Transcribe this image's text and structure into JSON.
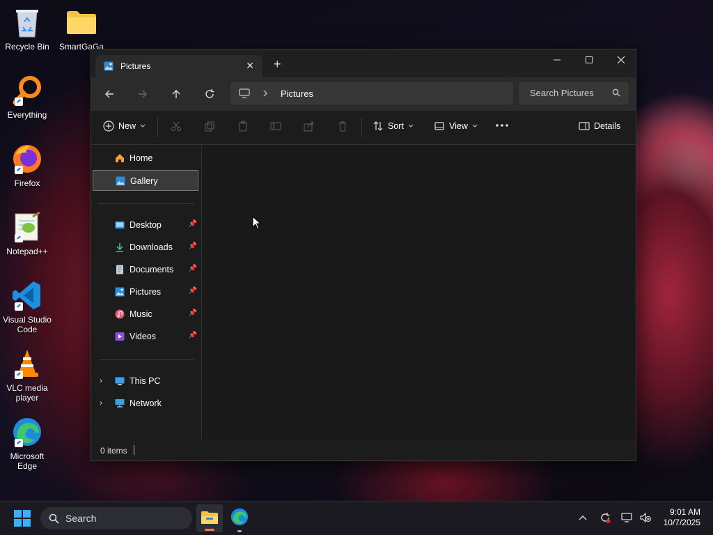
{
  "desktop": {
    "icons": [
      {
        "label": "Recycle Bin"
      },
      {
        "label": "SmartGaGa"
      },
      {
        "label": "Everything"
      },
      {
        "label": "Firefox"
      },
      {
        "label": "Notepad++"
      },
      {
        "label": "Visual Studio Code"
      },
      {
        "label": "VLC media player"
      },
      {
        "label": "Microsoft Edge"
      }
    ]
  },
  "window": {
    "tab_title": "Pictures",
    "tab_close": "✕",
    "new_tab": "+",
    "address_crumb": "Pictures",
    "search_placeholder": "Search Pictures",
    "toolbar": {
      "new_label": "New",
      "sort_label": "Sort",
      "view_label": "View",
      "details_label": "Details"
    },
    "nav": {
      "home": "Home",
      "gallery": "Gallery",
      "pinned": [
        {
          "label": "Desktop"
        },
        {
          "label": "Downloads"
        },
        {
          "label": "Documents"
        },
        {
          "label": "Pictures"
        },
        {
          "label": "Music"
        },
        {
          "label": "Videos"
        }
      ],
      "this_pc": "This PC",
      "network": "Network"
    },
    "status_text": "0 items"
  },
  "taskbar": {
    "search_label": "Search",
    "time": "9:01 AM",
    "date": "10/7/2025"
  },
  "colors": {
    "accent": "#0078d4",
    "window_bg": "#1c1c1c"
  }
}
